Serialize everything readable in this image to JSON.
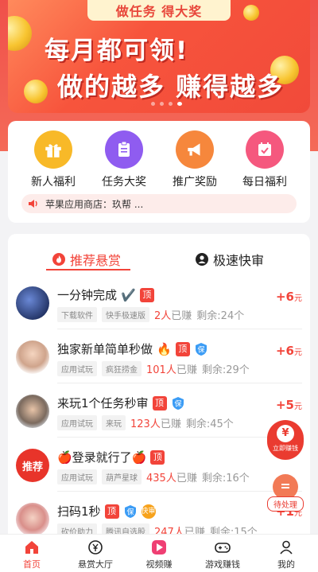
{
  "banner": {
    "chip": "做任务 得大奖",
    "line1": "每月都可领!",
    "line2": "做的越多 赚得越多"
  },
  "features": [
    {
      "label": "新人福利",
      "icon": "gift-icon",
      "color": "#f8b928"
    },
    {
      "label": "任务大奖",
      "icon": "clipboard-icon",
      "color": "#8f5cf0"
    },
    {
      "label": "推广奖励",
      "icon": "megaphone-icon",
      "color": "#f6873c"
    },
    {
      "label": "每日福利",
      "icon": "calendar-check-icon",
      "color": "#f5587e"
    }
  ],
  "notice": {
    "text": "苹果应用商店：玖帮 ..."
  },
  "tabs": {
    "active": "推荐悬赏",
    "other": "极速快审"
  },
  "tasks": [
    {
      "title": "一分钟完成",
      "emoji": "✔️",
      "ding": "顶",
      "bao": false,
      "kuai": false,
      "tags": [
        "下载软件",
        "快手极速版"
      ],
      "done_count": "2人",
      "done_suffix": "已赚",
      "left": "剩余:24个",
      "reward": "+6",
      "unit": "元"
    },
    {
      "title": "独家新单简单秒做",
      "emoji": "🔥",
      "ding": "顶",
      "bao": true,
      "kuai": false,
      "tags": [
        "应用试玩",
        "疯狂捞金"
      ],
      "done_count": "101人",
      "done_suffix": "已赚",
      "left": "剩余:29个",
      "reward": "+6",
      "unit": "元"
    },
    {
      "title": "来玩1个任务秒审",
      "emoji": "",
      "ding": "顶",
      "bao": true,
      "kuai": false,
      "tags": [
        "应用试玩",
        "来玩"
      ],
      "done_count": "123人",
      "done_suffix": "已赚",
      "left": "剩余:45个",
      "reward": "+5",
      "unit": "元"
    },
    {
      "title": "🍎登录就行了🍎",
      "emoji": "",
      "ding": "顶",
      "bao": false,
      "kuai": false,
      "tags": [
        "应用试玩",
        "葫芦星球"
      ],
      "done_count": "435人",
      "done_suffix": "已赚",
      "left": "剩余:16个",
      "reward": "",
      "unit": ""
    },
    {
      "title": "扫码1秒",
      "emoji": "",
      "ding": "顶",
      "bao": true,
      "kuai": true,
      "kuai_label": "快审",
      "tags": [
        "砍价助力",
        "腾讯自选股"
      ],
      "done_count": "247人",
      "done_suffix": "已赚",
      "left": "剩余:15个",
      "reward": "+1",
      "unit": "元"
    }
  ],
  "avatar_badge": "推荐",
  "floats": {
    "earn": "立即赚钱",
    "earn_symbol": "¥",
    "pending": "待处理"
  },
  "nav": [
    {
      "label": "首页",
      "icon": "home-icon",
      "active": true
    },
    {
      "label": "悬赏大厅",
      "icon": "yen-circle-icon",
      "active": false
    },
    {
      "label": "视频赚",
      "icon": "video-play-icon",
      "active": false
    },
    {
      "label": "游戏赚钱",
      "icon": "gamepad-icon",
      "active": false
    },
    {
      "label": "我的",
      "icon": "person-icon",
      "active": false
    }
  ],
  "colors": {
    "accent": "#f2443a",
    "banner": "#f14a3a"
  }
}
